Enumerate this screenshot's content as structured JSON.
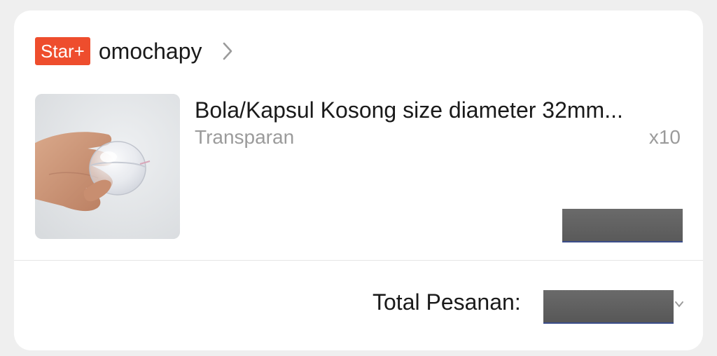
{
  "order_card": {
    "shop": {
      "badge_label": "Star+",
      "name": "omochapy"
    },
    "product": {
      "title": "Bola/Kapsul Kosong size diameter 32mm...",
      "variant": "Transparan",
      "quantity": "x10",
      "thumbnail_icon": "product-photo-capsule"
    },
    "total": {
      "label": "Total Pesanan:"
    }
  },
  "colors": {
    "badge_bg": "#ee4d2d",
    "text_primary": "#1a1a1a",
    "text_secondary": "#9b9b9b",
    "card_bg": "#ffffff",
    "page_bg": "#efefef",
    "redaction": "#5f5f5f"
  }
}
